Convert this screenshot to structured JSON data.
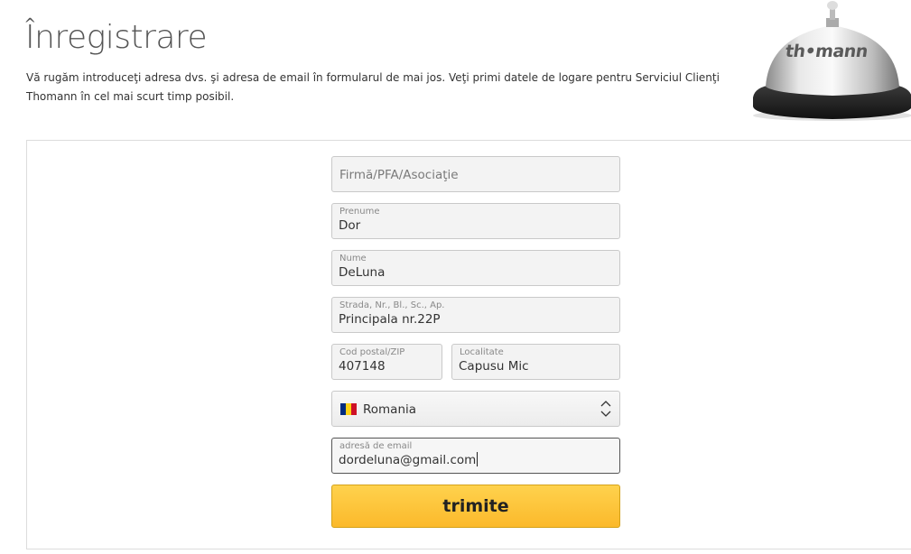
{
  "page": {
    "title": "Înregistrare",
    "intro": "Vă rugăm introduceţi adresa dvs. şi adresa de email în formularul de mai jos. Veţi primi datele de logare pentru Serviciul Clienţi Thomann în cel mai scurt timp posibil."
  },
  "brand": {
    "bell_text": "th•mann"
  },
  "form": {
    "company": {
      "placeholder": "Firmă/PFA/Asociaţie",
      "value": ""
    },
    "first_name": {
      "label": "Prenume",
      "value": "Dor"
    },
    "last_name": {
      "label": "Nume",
      "value": "DeLuna"
    },
    "street": {
      "label": "Strada, Nr., Bl., Sc., Ap.",
      "value": "Principala nr.22P"
    },
    "zip": {
      "label": "Cod postal/ZIP",
      "value": "407148"
    },
    "city": {
      "label": "Localitate",
      "value": "Capusu Mic"
    },
    "country": {
      "value": "Romania",
      "flag_icon": "romania-flag-icon",
      "flag_colors": [
        "#002B7F",
        "#FCD116",
        "#CE1126"
      ]
    },
    "email": {
      "label": "adresă de email",
      "value": "dordeluna@gmail.com"
    },
    "submit_label": "trimite"
  },
  "colors": {
    "button_accent": "#fbc02d",
    "active_border": "#555555"
  }
}
